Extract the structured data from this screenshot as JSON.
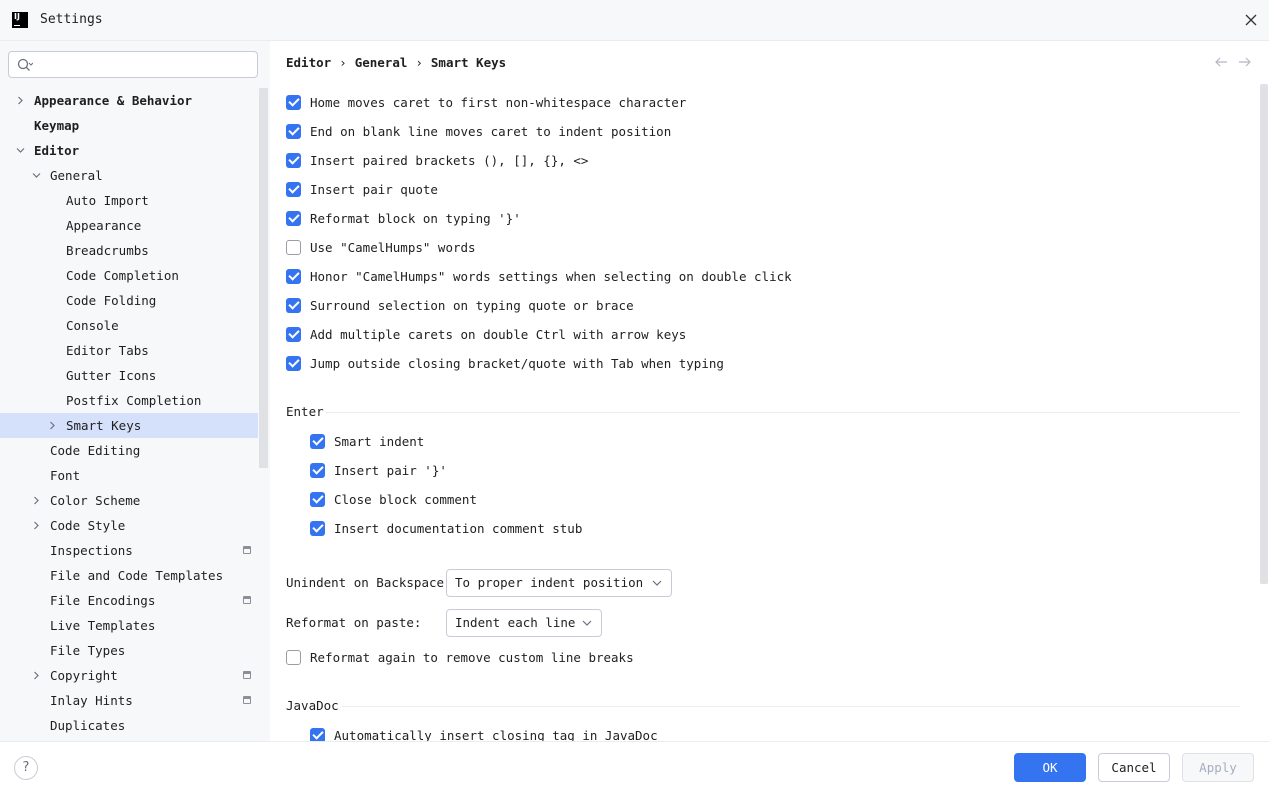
{
  "window": {
    "title": "Settings",
    "logo": "IJ"
  },
  "search": {
    "placeholder": ""
  },
  "tree": [
    {
      "label": "Appearance & Behavior",
      "level": 0,
      "bold": true,
      "arrow": "right"
    },
    {
      "label": "Keymap",
      "level": 0,
      "bold": true,
      "arrow": "none"
    },
    {
      "label": "Editor",
      "level": 0,
      "bold": true,
      "arrow": "down"
    },
    {
      "label": "General",
      "level": 1,
      "arrow": "down"
    },
    {
      "label": "Auto Import",
      "level": 2,
      "arrow": "none"
    },
    {
      "label": "Appearance",
      "level": 2,
      "arrow": "none"
    },
    {
      "label": "Breadcrumbs",
      "level": 2,
      "arrow": "none"
    },
    {
      "label": "Code Completion",
      "level": 2,
      "arrow": "none"
    },
    {
      "label": "Code Folding",
      "level": 2,
      "arrow": "none"
    },
    {
      "label": "Console",
      "level": 2,
      "arrow": "none"
    },
    {
      "label": "Editor Tabs",
      "level": 2,
      "arrow": "none"
    },
    {
      "label": "Gutter Icons",
      "level": 2,
      "arrow": "none"
    },
    {
      "label": "Postfix Completion",
      "level": 2,
      "arrow": "none"
    },
    {
      "label": "Smart Keys",
      "level": 2,
      "arrow": "right",
      "selected": true
    },
    {
      "label": "Code Editing",
      "level": 1,
      "arrow": "none"
    },
    {
      "label": "Font",
      "level": 1,
      "arrow": "none"
    },
    {
      "label": "Color Scheme",
      "level": 1,
      "arrow": "right"
    },
    {
      "label": "Code Style",
      "level": 1,
      "arrow": "right"
    },
    {
      "label": "Inspections",
      "level": 1,
      "arrow": "none",
      "project_icon": true
    },
    {
      "label": "File and Code Templates",
      "level": 1,
      "arrow": "none"
    },
    {
      "label": "File Encodings",
      "level": 1,
      "arrow": "none",
      "project_icon": true
    },
    {
      "label": "Live Templates",
      "level": 1,
      "arrow": "none"
    },
    {
      "label": "File Types",
      "level": 1,
      "arrow": "none"
    },
    {
      "label": "Copyright",
      "level": 1,
      "arrow": "right",
      "project_icon": true
    },
    {
      "label": "Inlay Hints",
      "level": 1,
      "arrow": "none",
      "project_icon": true
    },
    {
      "label": "Duplicates",
      "level": 1,
      "arrow": "none"
    }
  ],
  "breadcrumb": [
    "Editor",
    "General",
    "Smart Keys"
  ],
  "breadcrumb_sep": "›",
  "options": [
    {
      "label": "Home moves caret to first non-whitespace character",
      "checked": true
    },
    {
      "label": "End on blank line moves caret to indent position",
      "checked": true
    },
    {
      "label": "Insert paired brackets (), [], {}, <>",
      "checked": true
    },
    {
      "label": "Insert pair quote",
      "checked": true
    },
    {
      "label": "Reformat block on typing '}'",
      "checked": true
    },
    {
      "label": "Use \"CamelHumps\" words",
      "checked": false
    },
    {
      "label": "Honor \"CamelHumps\" words settings when selecting on double click",
      "checked": true
    },
    {
      "label": "Surround selection on typing quote or brace",
      "checked": true
    },
    {
      "label": "Add multiple carets on double Ctrl with arrow keys",
      "checked": true
    },
    {
      "label": "Jump outside closing bracket/quote with Tab when typing",
      "checked": true
    }
  ],
  "enter": {
    "title": "Enter",
    "options": [
      {
        "label": "Smart indent",
        "checked": true
      },
      {
        "label": "Insert pair '}'",
        "checked": true
      },
      {
        "label": "Close block comment",
        "checked": true
      },
      {
        "label": "Insert documentation comment stub",
        "checked": true
      }
    ]
  },
  "unindent": {
    "label": "Unindent on Backspace:",
    "value": "To proper indent position"
  },
  "reformat_paste": {
    "label": "Reformat on paste:",
    "value": "Indent each line"
  },
  "reformat_again": {
    "label": "Reformat again to remove custom line breaks",
    "checked": false
  },
  "javadoc": {
    "title": "JavaDoc",
    "options": [
      {
        "label": "Automatically insert closing tag in JavaDoc",
        "checked": true
      }
    ]
  },
  "footer": {
    "help": "?",
    "ok": "OK",
    "cancel": "Cancel",
    "apply": "Apply"
  },
  "colors": {
    "accent": "#3574f0",
    "selection": "#d5e1fb",
    "sidebar_bg": "#f7f8fa"
  }
}
